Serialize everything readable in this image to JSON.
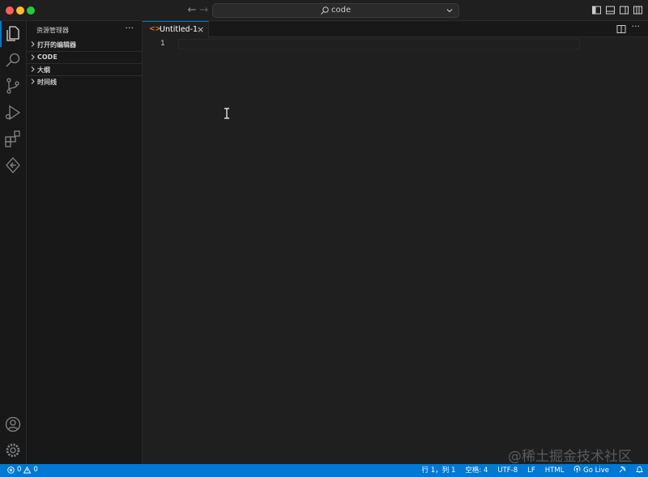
{
  "titlebar": {
    "search_text": "code",
    "icons": [
      "toggle-sidebar-icon",
      "toggle-panel-icon",
      "toggle-secondary-sidebar-icon",
      "customize-layout-icon"
    ]
  },
  "activity_bar": {
    "items": [
      "explorer-icon",
      "search-icon",
      "source-control-icon",
      "run-debug-icon",
      "extensions-icon",
      "remote-explorer-icon"
    ],
    "bottom": [
      "accounts-icon",
      "manage-gear-icon"
    ]
  },
  "sidebar": {
    "title": "资源管理器",
    "more": "···",
    "sections": [
      {
        "label": "打开的编辑器"
      },
      {
        "label": "CODE"
      },
      {
        "label": "大纲"
      },
      {
        "label": "时间线"
      }
    ]
  },
  "editor": {
    "tab": {
      "icon": "<>",
      "name": "Untitled-1",
      "close": "×"
    },
    "line_number": "1",
    "more": "···"
  },
  "watermark": "@稀土掘金技术社区",
  "statusbar": {
    "errors": "0",
    "warnings": "0",
    "position": "行 1，列 1",
    "indent": "空格: 4",
    "encoding": "UTF-8",
    "eol": "LF",
    "language": "HTML",
    "golive": "Go Live"
  },
  "colors": {
    "accent": "#0078d4",
    "background": "#1f1f1f",
    "sidebar": "#181818",
    "html_icon": "#e37933"
  }
}
